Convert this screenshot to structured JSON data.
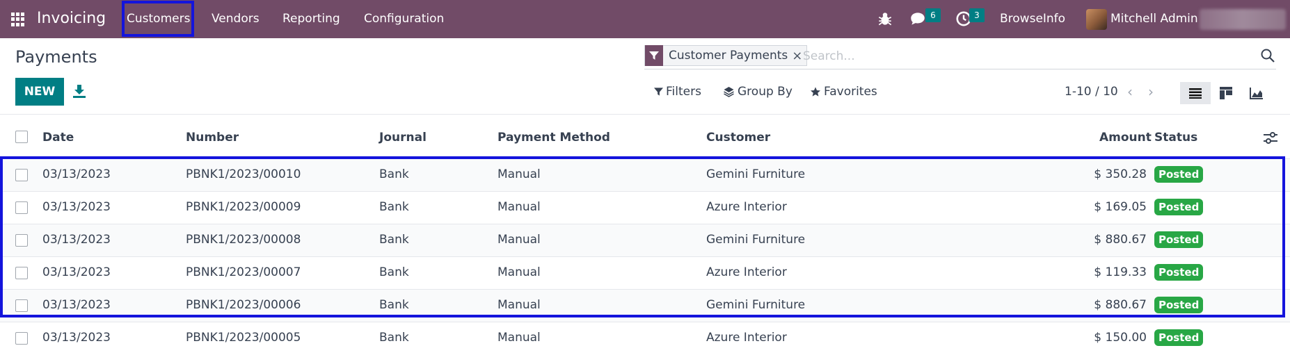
{
  "navbar": {
    "app_name": "Invoicing",
    "menu": [
      "Customers",
      "Vendors",
      "Reporting",
      "Configuration"
    ],
    "messages_count": "6",
    "activities_count": "3",
    "company": "BrowseInfo",
    "user": "Mitchell Admin",
    "bg_color": "#714b67"
  },
  "control_panel": {
    "title": "Payments",
    "new_label": "NEW",
    "facet_label": "Customer Payments",
    "facet_close": "×",
    "search_placeholder": "Search...",
    "filters_label": "Filters",
    "groupby_label": "Group By",
    "favorites_label": "Favorites",
    "pager": "1-10 / 10",
    "accent_color": "#017e84"
  },
  "table": {
    "headers": {
      "date": "Date",
      "number": "Number",
      "journal": "Journal",
      "method": "Payment Method",
      "customer": "Customer",
      "amount": "Amount",
      "status": "Status"
    },
    "rows": [
      {
        "date": "03/13/2023",
        "number": "PBNK1/2023/00010",
        "journal": "Bank",
        "method": "Manual",
        "customer": "Gemini Furniture",
        "amount": "$ 350.28",
        "status": "Posted"
      },
      {
        "date": "03/13/2023",
        "number": "PBNK1/2023/00009",
        "journal": "Bank",
        "method": "Manual",
        "customer": "Azure Interior",
        "amount": "$ 169.05",
        "status": "Posted"
      },
      {
        "date": "03/13/2023",
        "number": "PBNK1/2023/00008",
        "journal": "Bank",
        "method": "Manual",
        "customer": "Gemini Furniture",
        "amount": "$ 880.67",
        "status": "Posted"
      },
      {
        "date": "03/13/2023",
        "number": "PBNK1/2023/00007",
        "journal": "Bank",
        "method": "Manual",
        "customer": "Azure Interior",
        "amount": "$ 119.33",
        "status": "Posted"
      },
      {
        "date": "03/13/2023",
        "number": "PBNK1/2023/00006",
        "journal": "Bank",
        "method": "Manual",
        "customer": "Gemini Furniture",
        "amount": "$ 880.67",
        "status": "Posted"
      },
      {
        "date": "03/13/2023",
        "number": "PBNK1/2023/00005",
        "journal": "Bank",
        "method": "Manual",
        "customer": "Azure Interior",
        "amount": "$ 150.00",
        "status": "Posted"
      }
    ],
    "status_color": "#28a745"
  },
  "highlight_color": "#1414dc"
}
